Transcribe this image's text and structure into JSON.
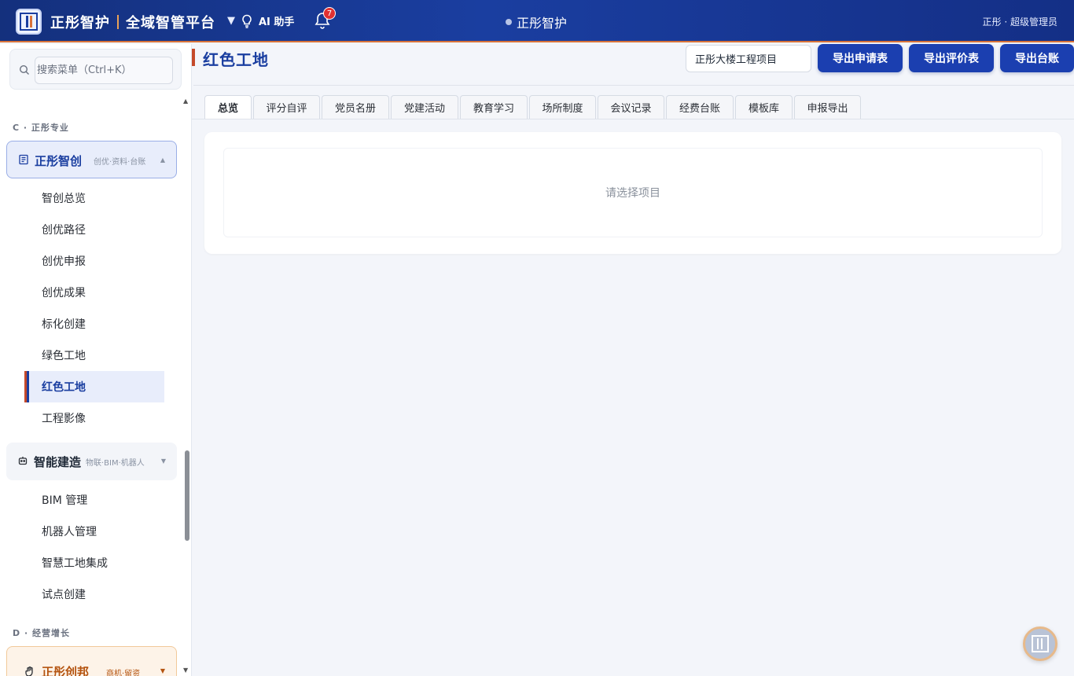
{
  "header": {
    "brand_name": "正彤智护",
    "platform_name": "全域智管平台",
    "ai_assistant": "AI 助手",
    "notification_count": "7",
    "center_title": "正彤智护",
    "user": "正彤 · 超级管理员"
  },
  "sidebar": {
    "search_placeholder": "搜索菜单（Ctrl+K）",
    "section_c": "C · 正彤专业",
    "group1": {
      "title": "正彤智创",
      "sub": "创优·资料·台账"
    },
    "group1_items": [
      "智创总览",
      "创优路径",
      "创优申报",
      "创优成果",
      "标化创建",
      "绿色工地",
      "红色工地",
      "工程影像"
    ],
    "group2": {
      "title": "智能建造",
      "sub": "物联·BIM·机器人"
    },
    "group2_items": [
      "BIM 管理",
      "机器人管理",
      "智慧工地集成",
      "试点创建"
    ],
    "section_d": "D · 经营增长",
    "group3": {
      "title": "正彤创邦",
      "sub": "商机·留资"
    }
  },
  "main": {
    "page_title": "红色工地",
    "project": "正彤大楼工程项目",
    "buttons": {
      "export_application": "导出申请表",
      "export_evaluation": "导出评价表",
      "export_ledger": "导出台账"
    },
    "tabs": [
      "总览",
      "评分自评",
      "党员名册",
      "党建活动",
      "教育学习",
      "场所制度",
      "会议记录",
      "经费台账",
      "模板库",
      "申报导出"
    ],
    "empty_text": "请选择项目"
  }
}
